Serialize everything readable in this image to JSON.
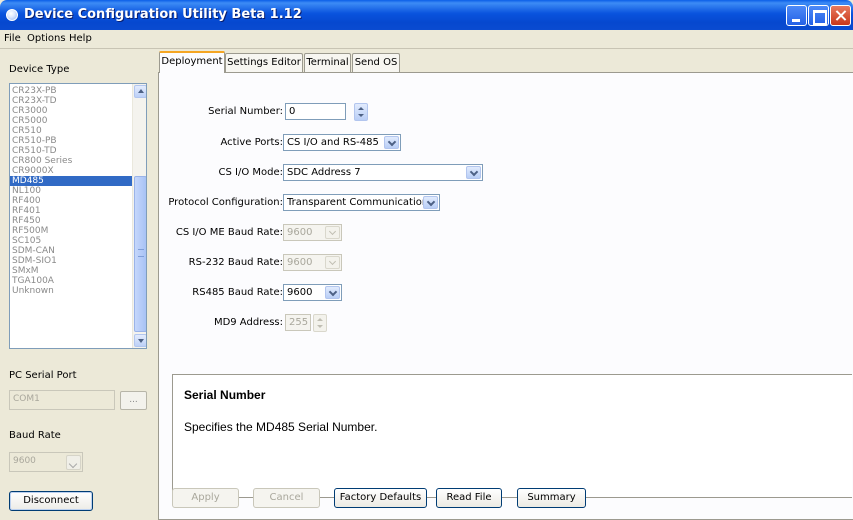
{
  "window": {
    "title": "Device Configuration Utility Beta 1.12"
  },
  "menu": [
    "File",
    "Options",
    "Help"
  ],
  "left": {
    "device_type_label": "Device Type",
    "devices": [
      "CR23X-PB",
      "CR23X-TD",
      "CR3000",
      "CR5000",
      "CR510",
      "CR510-PB",
      "CR510-TD",
      "CR800 Series",
      "CR9000X",
      "MD485",
      "NL100",
      "RF400",
      "RF401",
      "RF450",
      "RF500M",
      "SC105",
      "SDM-CAN",
      "SDM-SIO1",
      "SMxM",
      "TGA100A",
      "Unknown"
    ],
    "selected_device": "MD485",
    "pc_serial_port_label": "PC Serial Port",
    "pc_serial_port_value": "COM1",
    "browse_label": "...",
    "baud_rate_label": "Baud Rate",
    "baud_rate_value": "9600",
    "disconnect_label": "Disconnect"
  },
  "tabs": [
    "Deployment",
    "Settings Editor",
    "Terminal",
    "Send OS"
  ],
  "active_tab": "Deployment",
  "form": {
    "serial_number": {
      "label": "Serial Number:",
      "value": "0"
    },
    "active_ports": {
      "label": "Active Ports:",
      "value": "CS I/O and RS-485"
    },
    "csio_mode": {
      "label": "CS I/O Mode:",
      "value": "SDC Address 7"
    },
    "protocol": {
      "label": "Protocol Configuration:",
      "value": "Transparent Communication"
    },
    "csio_me_baud": {
      "label": "CS I/O ME Baud Rate:",
      "value": "9600"
    },
    "rs232_baud": {
      "label": "RS-232 Baud Rate:",
      "value": "9600"
    },
    "rs485_baud": {
      "label": "RS485 Baud Rate:",
      "value": "9600"
    },
    "md9_address": {
      "label": "MD9 Address:",
      "value": "255"
    }
  },
  "help": {
    "title": "Serial Number",
    "text": "Specifies the MD485 Serial Number."
  },
  "buttons": {
    "apply": "Apply",
    "cancel": "Cancel",
    "factory_defaults": "Factory Defaults",
    "read_file": "Read File",
    "summary": "Summary"
  }
}
